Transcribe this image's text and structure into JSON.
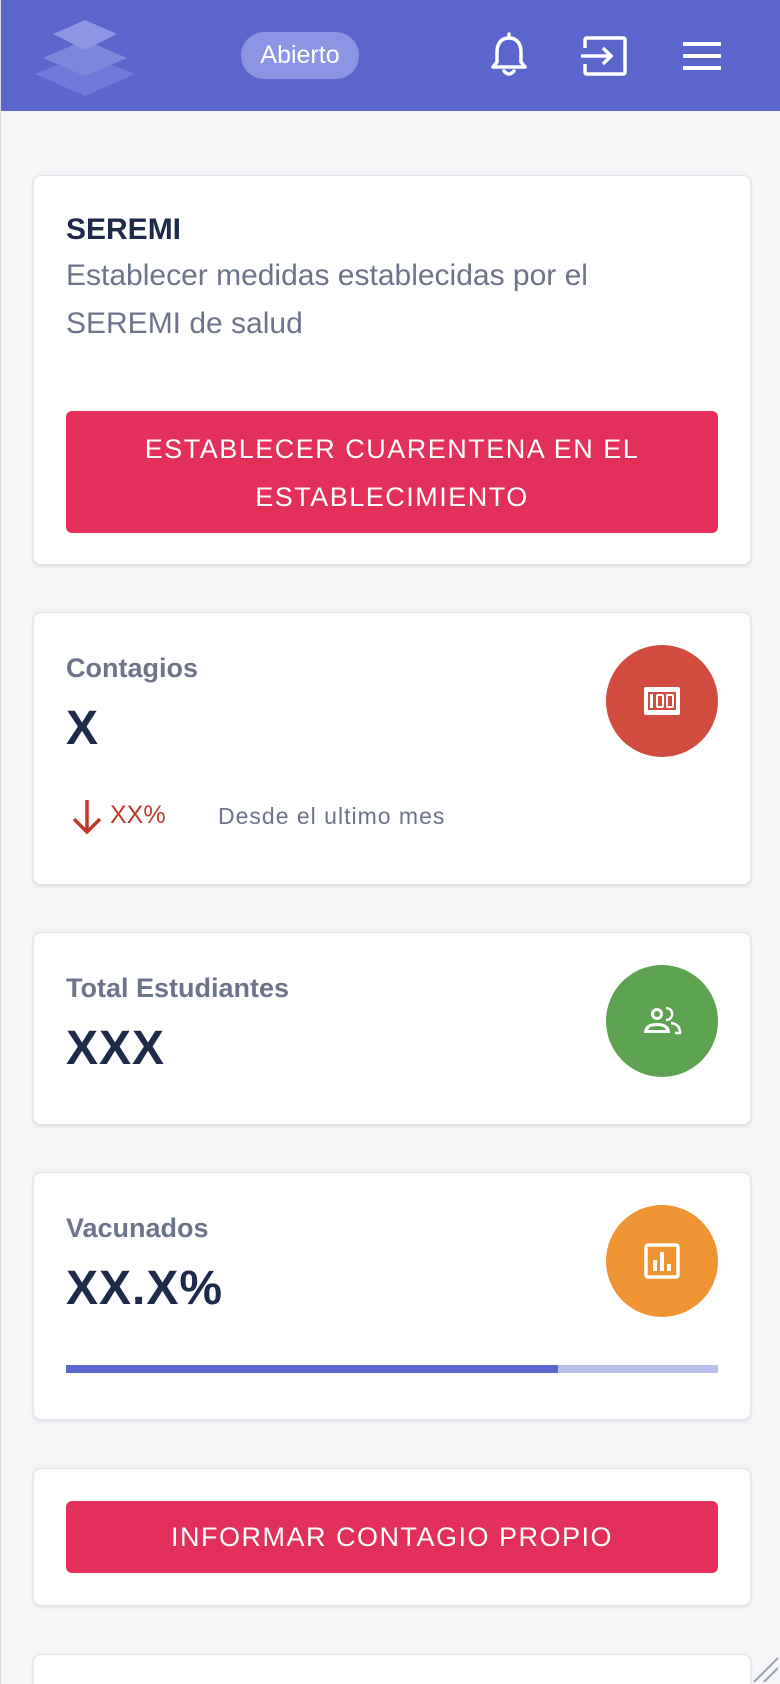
{
  "header": {
    "status_label": "Abierto",
    "icons": [
      "layers-logo-icon",
      "bell-icon",
      "login-icon",
      "menu-icon"
    ]
  },
  "seremi_card": {
    "title": "SEREMI",
    "description": "Establecer medidas establecidas por el SEREMI de salud",
    "button_line1": "ESTABLECER CUARENTENA EN EL",
    "button_line2": "ESTABLECIMIENTO"
  },
  "contagios_card": {
    "label": "Contagios",
    "value": "X",
    "trend_value": "XX%",
    "trend_note": "Desde el ultimo mes",
    "icon": "counter-100-icon",
    "icon_color": "#d14b3f"
  },
  "estudiantes_card": {
    "label": "Total Estudiantes",
    "value": "XXX",
    "icon": "people-icon",
    "icon_color": "#5ea352"
  },
  "vacunados_card": {
    "label": "Vacunados",
    "value": "XX.X%",
    "progress_fraction": 0.755,
    "icon": "bar-chart-icon",
    "icon_color": "#ee9433"
  },
  "report_card": {
    "button_label": "INFORMAR CONTAGIO PROPIO"
  },
  "colors": {
    "header": "#5b66cc",
    "accent_red": "#e3305b",
    "trend_down": "#c0392b"
  }
}
